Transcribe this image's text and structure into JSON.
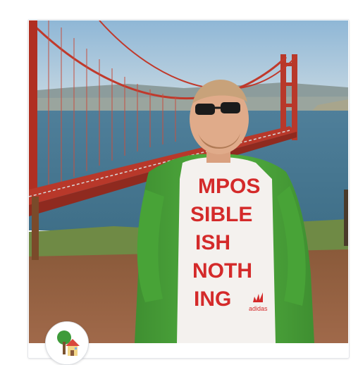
{
  "post": {
    "photo_icon": "photo-image",
    "avatar_icon": "house-avatar-icon"
  },
  "shirt": {
    "lines": [
      "MPOS",
      "SIBLE",
      "ISH",
      "NOTH",
      "ING"
    ],
    "brand": "adidas"
  },
  "colors": {
    "card_border": "#e4e6eb",
    "bridge_red": "#c0392b",
    "jacket_green": "#4aa63a",
    "shirt_text": "#d42a2a"
  }
}
